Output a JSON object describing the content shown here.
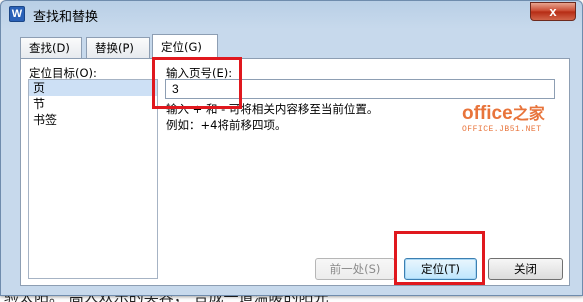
{
  "window": {
    "app_icon": "W",
    "title": "查找和替换",
    "close_glyph": "x"
  },
  "tabs": [
    {
      "label": "查找(D)"
    },
    {
      "label": "替换(P)"
    },
    {
      "label": "定位(G)"
    }
  ],
  "goto": {
    "target_label": "定位目标(O):",
    "targets": [
      {
        "label": "页"
      },
      {
        "label": "节"
      },
      {
        "label": "书签"
      }
    ],
    "page_label": "输入页号(E):",
    "page_value": "3",
    "hint_line1": "输入 + 和 - 可将相关内容移至当前位置。",
    "hint_line2": "例如：+4将前移四项。"
  },
  "watermark": {
    "main": "office",
    "main_cn": "之家",
    "sub": "OFFICE.JB51.NET"
  },
  "buttons": {
    "prev": "前一处(S)",
    "goto": "定位(T)",
    "close": "关闭"
  },
  "background_text": "验太阳。 高人欢乐的笑容， 合成一道温暖的阳光"
}
